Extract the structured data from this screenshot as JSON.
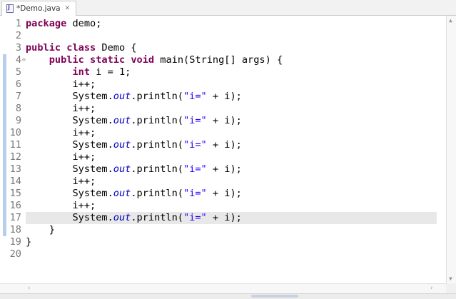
{
  "tab": {
    "title": "*Demo.java",
    "close_glyph": "✕",
    "icon": "java-file-icon"
  },
  "editor": {
    "fold_marker": "⊖",
    "lines": [
      {
        "n": "1",
        "segments": [
          [
            "kw",
            "package"
          ],
          [
            "t",
            " demo;"
          ]
        ]
      },
      {
        "n": "2",
        "segments": []
      },
      {
        "n": "3",
        "segments": [
          [
            "kw",
            "public"
          ],
          [
            "t",
            " "
          ],
          [
            "kw",
            "class"
          ],
          [
            "t",
            " Demo {"
          ]
        ]
      },
      {
        "n": "4",
        "segments": [
          [
            "t",
            "    "
          ],
          [
            "kw",
            "public"
          ],
          [
            "t",
            " "
          ],
          [
            "kw",
            "static"
          ],
          [
            "t",
            " "
          ],
          [
            "kw",
            "void"
          ],
          [
            "t",
            " main(String[] args) {"
          ]
        ]
      },
      {
        "n": "5",
        "segments": [
          [
            "t",
            "        "
          ],
          [
            "kw",
            "int"
          ],
          [
            "t",
            " i = 1;"
          ]
        ]
      },
      {
        "n": "6",
        "segments": [
          [
            "t",
            "        i++;"
          ]
        ]
      },
      {
        "n": "7",
        "segments": [
          [
            "t",
            "        System."
          ],
          [
            "fld",
            "out"
          ],
          [
            "t",
            ".println("
          ],
          [
            "str",
            "\"i=\""
          ],
          [
            "t",
            " + i);"
          ]
        ]
      },
      {
        "n": "8",
        "segments": [
          [
            "t",
            "        i++;"
          ]
        ]
      },
      {
        "n": "9",
        "segments": [
          [
            "t",
            "        System."
          ],
          [
            "fld",
            "out"
          ],
          [
            "t",
            ".println("
          ],
          [
            "str",
            "\"i=\""
          ],
          [
            "t",
            " + i);"
          ]
        ]
      },
      {
        "n": "10",
        "segments": [
          [
            "t",
            "        i++;"
          ]
        ]
      },
      {
        "n": "11",
        "segments": [
          [
            "t",
            "        System."
          ],
          [
            "fld",
            "out"
          ],
          [
            "t",
            ".println("
          ],
          [
            "str",
            "\"i=\""
          ],
          [
            "t",
            " + i);"
          ]
        ]
      },
      {
        "n": "12",
        "segments": [
          [
            "t",
            "        i++;"
          ]
        ]
      },
      {
        "n": "13",
        "segments": [
          [
            "t",
            "        System."
          ],
          [
            "fld",
            "out"
          ],
          [
            "t",
            ".println("
          ],
          [
            "str",
            "\"i=\""
          ],
          [
            "t",
            " + i);"
          ]
        ]
      },
      {
        "n": "14",
        "segments": [
          [
            "t",
            "        i++;"
          ]
        ]
      },
      {
        "n": "15",
        "segments": [
          [
            "t",
            "        System."
          ],
          [
            "fld",
            "out"
          ],
          [
            "t",
            ".println("
          ],
          [
            "str",
            "\"i=\""
          ],
          [
            "t",
            " + i);"
          ]
        ]
      },
      {
        "n": "16",
        "segments": [
          [
            "t",
            "        i++;"
          ]
        ]
      },
      {
        "n": "17",
        "segments": [
          [
            "t",
            "        System."
          ],
          [
            "fld",
            "out"
          ],
          [
            "t",
            ".println("
          ],
          [
            "str",
            "\"i=\""
          ],
          [
            "t",
            " + i);"
          ]
        ]
      },
      {
        "n": "18",
        "segments": [
          [
            "t",
            "    }"
          ]
        ]
      },
      {
        "n": "19",
        "segments": [
          [
            "t",
            "}"
          ]
        ]
      },
      {
        "n": "20",
        "segments": []
      }
    ],
    "current_line": "17",
    "changed_lines": [
      "4",
      "5",
      "6",
      "7",
      "8",
      "9",
      "10",
      "11",
      "12",
      "13",
      "14",
      "15",
      "16",
      "17",
      "18"
    ]
  },
  "scrollbars": {
    "up": "▲",
    "down": "▼",
    "left": "‹",
    "right": "›"
  },
  "colors": {
    "keyword": "#7f0055",
    "field": "#0000c0",
    "string": "#2a00ff",
    "line_number": "#787878",
    "current_line": "#e8e8e8",
    "change_bar": "#b8cfec"
  }
}
